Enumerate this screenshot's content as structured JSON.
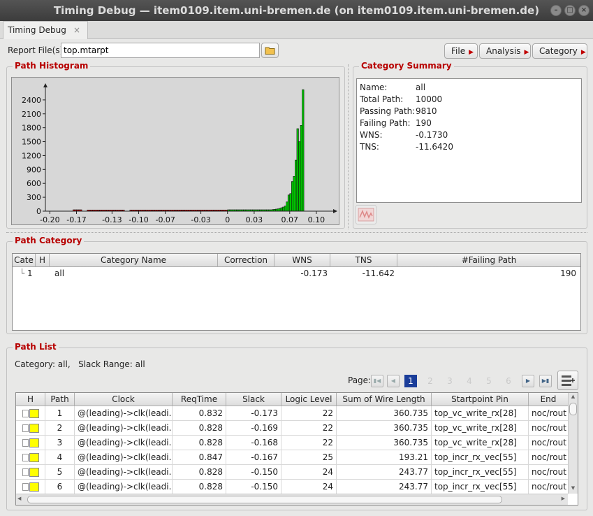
{
  "window": {
    "title": "Timing Debug — item0109.item.uni-bremen.de (on item0109.item.uni-bremen.de)"
  },
  "tab": {
    "label": "Timing Debug",
    "close": "×"
  },
  "toolbar": {
    "report_label": "Report File(s)",
    "report_value": "top.mtarpt",
    "file": "File",
    "analysis": "Analysis",
    "category": "Category"
  },
  "histogram": {
    "title": "Path Histogram"
  },
  "chart_data": {
    "type": "bar",
    "title": "Path Histogram",
    "xlabel": "",
    "ylabel": "",
    "xlim": [
      -0.205,
      0.115
    ],
    "ylim": [
      0,
      2700
    ],
    "yticks": [
      0,
      300,
      600,
      900,
      1200,
      1500,
      1800,
      2100,
      2400
    ],
    "xticks": [
      "-0.20",
      "-0.17",
      "-0.13",
      "-0.10",
      "-0.07",
      "-0.03",
      "0",
      "0.03",
      "0.07",
      "0.10"
    ],
    "xtick_values": [
      -0.2,
      -0.17,
      -0.13,
      -0.1,
      -0.07,
      -0.03,
      0,
      0.03,
      0.07,
      0.1
    ],
    "colors": {
      "failing": "#d90000",
      "passing": "#00cc00"
    },
    "bins": [
      {
        "x": -0.174,
        "v": 30,
        "c": "failing"
      },
      {
        "x": -0.172,
        "v": 30,
        "c": "failing"
      },
      {
        "x": -0.17,
        "v": 30,
        "c": "failing"
      },
      {
        "x": -0.168,
        "v": 30,
        "c": "failing"
      },
      {
        "x": -0.166,
        "v": 30,
        "c": "failing"
      },
      {
        "x": -0.158,
        "v": 25,
        "c": "failing"
      },
      {
        "x": -0.156,
        "v": 25,
        "c": "failing"
      },
      {
        "x": -0.154,
        "v": 25,
        "c": "failing"
      },
      {
        "x": -0.152,
        "v": 25,
        "c": "failing"
      },
      {
        "x": -0.15,
        "v": 25,
        "c": "failing"
      },
      {
        "x": -0.148,
        "v": 25,
        "c": "failing"
      },
      {
        "x": -0.146,
        "v": 25,
        "c": "failing"
      },
      {
        "x": -0.144,
        "v": 25,
        "c": "failing"
      },
      {
        "x": -0.142,
        "v": 25,
        "c": "failing"
      },
      {
        "x": -0.14,
        "v": 25,
        "c": "failing"
      },
      {
        "x": -0.138,
        "v": 25,
        "c": "failing"
      },
      {
        "x": -0.136,
        "v": 25,
        "c": "failing"
      },
      {
        "x": -0.134,
        "v": 25,
        "c": "failing"
      },
      {
        "x": -0.132,
        "v": 25,
        "c": "failing"
      },
      {
        "x": -0.13,
        "v": 25,
        "c": "failing"
      },
      {
        "x": -0.128,
        "v": 25,
        "c": "failing"
      },
      {
        "x": -0.126,
        "v": 25,
        "c": "failing"
      },
      {
        "x": -0.124,
        "v": 25,
        "c": "failing"
      },
      {
        "x": -0.122,
        "v": 25,
        "c": "failing"
      },
      {
        "x": -0.12,
        "v": 25,
        "c": "failing"
      },
      {
        "x": -0.118,
        "v": 25,
        "c": "failing"
      },
      {
        "x": -0.11,
        "v": 25,
        "c": "failing"
      },
      {
        "x": -0.108,
        "v": 25,
        "c": "failing"
      },
      {
        "x": -0.106,
        "v": 25,
        "c": "failing"
      },
      {
        "x": -0.104,
        "v": 25,
        "c": "failing"
      },
      {
        "x": -0.102,
        "v": 25,
        "c": "failing"
      },
      {
        "x": -0.1,
        "v": 25,
        "c": "failing"
      },
      {
        "x": -0.098,
        "v": 25,
        "c": "failing"
      },
      {
        "x": -0.096,
        "v": 25,
        "c": "failing"
      },
      {
        "x": -0.094,
        "v": 25,
        "c": "failing"
      },
      {
        "x": -0.092,
        "v": 25,
        "c": "failing"
      },
      {
        "x": -0.09,
        "v": 25,
        "c": "failing"
      },
      {
        "x": -0.088,
        "v": 25,
        "c": "failing"
      },
      {
        "x": -0.086,
        "v": 25,
        "c": "failing"
      },
      {
        "x": -0.084,
        "v": 25,
        "c": "failing"
      },
      {
        "x": -0.082,
        "v": 25,
        "c": "failing"
      },
      {
        "x": -0.08,
        "v": 25,
        "c": "failing"
      },
      {
        "x": -0.078,
        "v": 25,
        "c": "failing"
      },
      {
        "x": -0.076,
        "v": 25,
        "c": "failing"
      },
      {
        "x": -0.074,
        "v": 25,
        "c": "failing"
      },
      {
        "x": -0.072,
        "v": 25,
        "c": "failing"
      },
      {
        "x": -0.07,
        "v": 25,
        "c": "failing"
      },
      {
        "x": -0.068,
        "v": 25,
        "c": "failing"
      },
      {
        "x": -0.066,
        "v": 25,
        "c": "failing"
      },
      {
        "x": -0.064,
        "v": 25,
        "c": "failing"
      },
      {
        "x": -0.062,
        "v": 25,
        "c": "failing"
      },
      {
        "x": -0.06,
        "v": 25,
        "c": "failing"
      },
      {
        "x": -0.058,
        "v": 25,
        "c": "failing"
      },
      {
        "x": -0.056,
        "v": 25,
        "c": "failing"
      },
      {
        "x": -0.054,
        "v": 25,
        "c": "failing"
      },
      {
        "x": -0.052,
        "v": 25,
        "c": "failing"
      },
      {
        "x": -0.05,
        "v": 25,
        "c": "failing"
      },
      {
        "x": -0.048,
        "v": 25,
        "c": "failing"
      },
      {
        "x": -0.046,
        "v": 25,
        "c": "failing"
      },
      {
        "x": -0.044,
        "v": 25,
        "c": "failing"
      },
      {
        "x": -0.042,
        "v": 25,
        "c": "failing"
      },
      {
        "x": -0.04,
        "v": 25,
        "c": "failing"
      },
      {
        "x": -0.038,
        "v": 25,
        "c": "failing"
      },
      {
        "x": -0.036,
        "v": 25,
        "c": "failing"
      },
      {
        "x": -0.034,
        "v": 25,
        "c": "failing"
      },
      {
        "x": -0.032,
        "v": 25,
        "c": "failing"
      },
      {
        "x": -0.03,
        "v": 25,
        "c": "failing"
      },
      {
        "x": -0.028,
        "v": 25,
        "c": "failing"
      },
      {
        "x": -0.026,
        "v": 25,
        "c": "failing"
      },
      {
        "x": -0.024,
        "v": 25,
        "c": "failing"
      },
      {
        "x": -0.022,
        "v": 25,
        "c": "failing"
      },
      {
        "x": -0.02,
        "v": 25,
        "c": "failing"
      },
      {
        "x": -0.018,
        "v": 25,
        "c": "failing"
      },
      {
        "x": -0.016,
        "v": 25,
        "c": "failing"
      },
      {
        "x": -0.014,
        "v": 25,
        "c": "failing"
      },
      {
        "x": -0.012,
        "v": 25,
        "c": "failing"
      },
      {
        "x": -0.01,
        "v": 25,
        "c": "failing"
      },
      {
        "x": -0.008,
        "v": 25,
        "c": "failing"
      },
      {
        "x": -0.006,
        "v": 25,
        "c": "failing"
      },
      {
        "x": -0.004,
        "v": 25,
        "c": "failing"
      },
      {
        "x": -0.002,
        "v": 25,
        "c": "failing"
      },
      {
        "x": 0.0,
        "v": 30,
        "c": "passing"
      },
      {
        "x": 0.002,
        "v": 30,
        "c": "passing"
      },
      {
        "x": 0.004,
        "v": 30,
        "c": "passing"
      },
      {
        "x": 0.006,
        "v": 30,
        "c": "passing"
      },
      {
        "x": 0.008,
        "v": 30,
        "c": "passing"
      },
      {
        "x": 0.01,
        "v": 30,
        "c": "passing"
      },
      {
        "x": 0.012,
        "v": 30,
        "c": "passing"
      },
      {
        "x": 0.014,
        "v": 30,
        "c": "passing"
      },
      {
        "x": 0.016,
        "v": 30,
        "c": "passing"
      },
      {
        "x": 0.018,
        "v": 30,
        "c": "passing"
      },
      {
        "x": 0.02,
        "v": 30,
        "c": "passing"
      },
      {
        "x": 0.022,
        "v": 30,
        "c": "passing"
      },
      {
        "x": 0.024,
        "v": 30,
        "c": "passing"
      },
      {
        "x": 0.026,
        "v": 30,
        "c": "passing"
      },
      {
        "x": 0.028,
        "v": 30,
        "c": "passing"
      },
      {
        "x": 0.03,
        "v": 30,
        "c": "passing"
      },
      {
        "x": 0.032,
        "v": 30,
        "c": "passing"
      },
      {
        "x": 0.034,
        "v": 30,
        "c": "passing"
      },
      {
        "x": 0.036,
        "v": 30,
        "c": "passing"
      },
      {
        "x": 0.038,
        "v": 30,
        "c": "passing"
      },
      {
        "x": 0.04,
        "v": 30,
        "c": "passing"
      },
      {
        "x": 0.042,
        "v": 30,
        "c": "passing"
      },
      {
        "x": 0.044,
        "v": 30,
        "c": "passing"
      },
      {
        "x": 0.046,
        "v": 30,
        "c": "passing"
      },
      {
        "x": 0.048,
        "v": 30,
        "c": "passing"
      },
      {
        "x": 0.05,
        "v": 35,
        "c": "passing"
      },
      {
        "x": 0.052,
        "v": 40,
        "c": "passing"
      },
      {
        "x": 0.054,
        "v": 45,
        "c": "passing"
      },
      {
        "x": 0.056,
        "v": 50,
        "c": "passing"
      },
      {
        "x": 0.058,
        "v": 60,
        "c": "passing"
      },
      {
        "x": 0.06,
        "v": 75,
        "c": "passing"
      },
      {
        "x": 0.062,
        "v": 90,
        "c": "passing"
      },
      {
        "x": 0.064,
        "v": 110,
        "c": "passing"
      },
      {
        "x": 0.066,
        "v": 200,
        "c": "passing"
      },
      {
        "x": 0.068,
        "v": 350,
        "c": "passing"
      },
      {
        "x": 0.07,
        "v": 380,
        "c": "passing"
      },
      {
        "x": 0.072,
        "v": 640,
        "c": "passing"
      },
      {
        "x": 0.074,
        "v": 750,
        "c": "passing"
      },
      {
        "x": 0.076,
        "v": 1100,
        "c": "passing"
      },
      {
        "x": 0.078,
        "v": 1780,
        "c": "passing"
      },
      {
        "x": 0.08,
        "v": 1500,
        "c": "passing"
      },
      {
        "x": 0.082,
        "v": 1850,
        "c": "passing"
      },
      {
        "x": 0.084,
        "v": 2620,
        "c": "passing"
      }
    ]
  },
  "summary": {
    "title": "Category Summary",
    "rows": [
      {
        "k": "Name:",
        "v": "all"
      },
      {
        "k": "Total Path:",
        "v": "10000"
      },
      {
        "k": "Passing Path:",
        "v": "9810"
      },
      {
        "k": "Failing Path:",
        "v": "190"
      },
      {
        "k": "WNS:",
        "v": "-0.1730"
      },
      {
        "k": "TNS:",
        "v": "-11.6420"
      }
    ]
  },
  "category": {
    "title": "Path Category",
    "headers": [
      "Cate",
      "H",
      "Category Name",
      "Correction",
      "WNS",
      "TNS",
      "#Failing Path"
    ],
    "row": {
      "id": "1",
      "name": "all",
      "correction": "",
      "wns": "-0.173",
      "tns": "-11.642",
      "failing": "190"
    }
  },
  "pathlist": {
    "title": "Path List",
    "filter": "Category: all,   Slack Range: all",
    "page_label": "Page:",
    "pages": [
      "1",
      "2",
      "3",
      "4",
      "5",
      "6"
    ],
    "headers": [
      "H",
      "Path",
      "Clock",
      "ReqTime",
      "Slack",
      "Logic Level",
      "Sum of Wire Length",
      "Startpoint Pin",
      "End"
    ],
    "rows": [
      {
        "path": "1",
        "clock": "@(leading)->clk(leadi...",
        "req": "0.832",
        "slack": "-0.173",
        "level": "22",
        "wire": "360.735",
        "start": "top_vc_write_rx[28]",
        "end": "noc/rout"
      },
      {
        "path": "2",
        "clock": "@(leading)->clk(leadi...",
        "req": "0.828",
        "slack": "-0.169",
        "level": "22",
        "wire": "360.735",
        "start": "top_vc_write_rx[28]",
        "end": "noc/rout"
      },
      {
        "path": "3",
        "clock": "@(leading)->clk(leadi...",
        "req": "0.828",
        "slack": "-0.168",
        "level": "22",
        "wire": "360.735",
        "start": "top_vc_write_rx[28]",
        "end": "noc/rout"
      },
      {
        "path": "4",
        "clock": "@(leading)->clk(leadi...",
        "req": "0.847",
        "slack": "-0.167",
        "level": "25",
        "wire": "193.21",
        "start": "top_incr_rx_vec[55]",
        "end": "noc/rout"
      },
      {
        "path": "5",
        "clock": "@(leading)->clk(leadi...",
        "req": "0.828",
        "slack": "-0.150",
        "level": "24",
        "wire": "243.77",
        "start": "top_incr_rx_vec[55]",
        "end": "noc/rout"
      },
      {
        "path": "6",
        "clock": "@(leading)->clk(leadi...",
        "req": "0.828",
        "slack": "-0.150",
        "level": "24",
        "wire": "243.77",
        "start": "top_incr_rx_vec[55]",
        "end": "noc/rout"
      }
    ]
  },
  "colors": {
    "accent": "#b70000",
    "highlight": "#ffff00",
    "page_active": "#1a3d99"
  }
}
